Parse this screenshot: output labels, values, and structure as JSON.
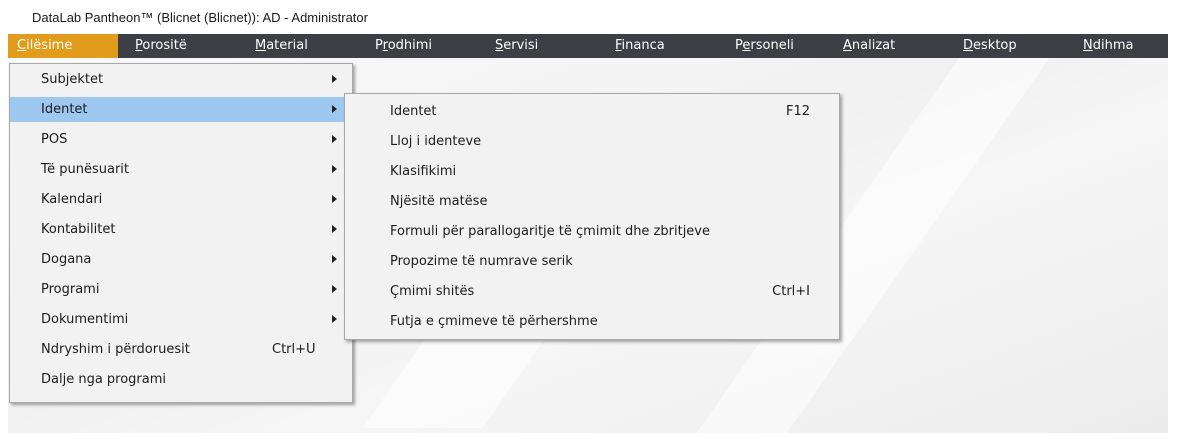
{
  "window": {
    "title": "DataLab Pantheon™  (Blicnet (Blicnet)): AD - Administrator"
  },
  "menubar": {
    "items": [
      {
        "label": "Cilësime",
        "mnemonic": "C",
        "rest": "ilësime",
        "active": true
      },
      {
        "label": "Porositë",
        "mnemonic": "P",
        "rest": "orositë"
      },
      {
        "label": "Material",
        "mnemonic": "M",
        "rest": "aterial"
      },
      {
        "label": "Prodhimi",
        "pre": "P",
        "mnemonic": "r",
        "rest": "odhimi"
      },
      {
        "label": "Servisi",
        "mnemonic": "S",
        "rest": "ervisi"
      },
      {
        "label": "Financa",
        "mnemonic": "F",
        "rest": "inanca"
      },
      {
        "label": "Personeli",
        "pre": "P",
        "mnemonic": "e",
        "rest": "rsoneli"
      },
      {
        "label": "Analizat",
        "mnemonic": "A",
        "rest": "nalizat"
      },
      {
        "label": "Desktop",
        "mnemonic": "D",
        "rest": "esktop"
      },
      {
        "label": "Ndihma",
        "mnemonic": "N",
        "rest": "dihma"
      }
    ],
    "active_color": "#e09c1a",
    "bar_color": "#3c4044"
  },
  "settings_menu": {
    "items": [
      {
        "label": "Subjektet",
        "submenu": true
      },
      {
        "label": "Identet",
        "submenu": true,
        "highlighted": true
      },
      {
        "label": "POS",
        "submenu": true
      },
      {
        "label": "Të punësuarit",
        "submenu": true
      },
      {
        "label": "Kalendari",
        "submenu": true
      },
      {
        "label": "Kontabilitet",
        "submenu": true
      },
      {
        "label": "Dogana",
        "submenu": true
      },
      {
        "label": "Programi",
        "submenu": true
      },
      {
        "label": "Dokumentimi",
        "submenu": true
      },
      {
        "label": "Ndryshim i përdoruesit",
        "shortcut": "Ctrl+U"
      },
      {
        "label": "Dalje nga programi"
      }
    ],
    "highlight_color": "#9ec8ef"
  },
  "identet_submenu": {
    "items": [
      {
        "label": "Identet",
        "shortcut": "F12"
      },
      {
        "label": "Lloj i identeve"
      },
      {
        "label": "Klasifikimi"
      },
      {
        "label": "Njësitë matëse"
      },
      {
        "label": "Formuli për parallogaritje të çmimit dhe zbritjeve"
      },
      {
        "label": "Propozime të numrave serik"
      },
      {
        "label": "Çmimi shitës",
        "shortcut": "Ctrl+I"
      },
      {
        "label": "Futja e çmimeve të përhershme"
      }
    ]
  }
}
